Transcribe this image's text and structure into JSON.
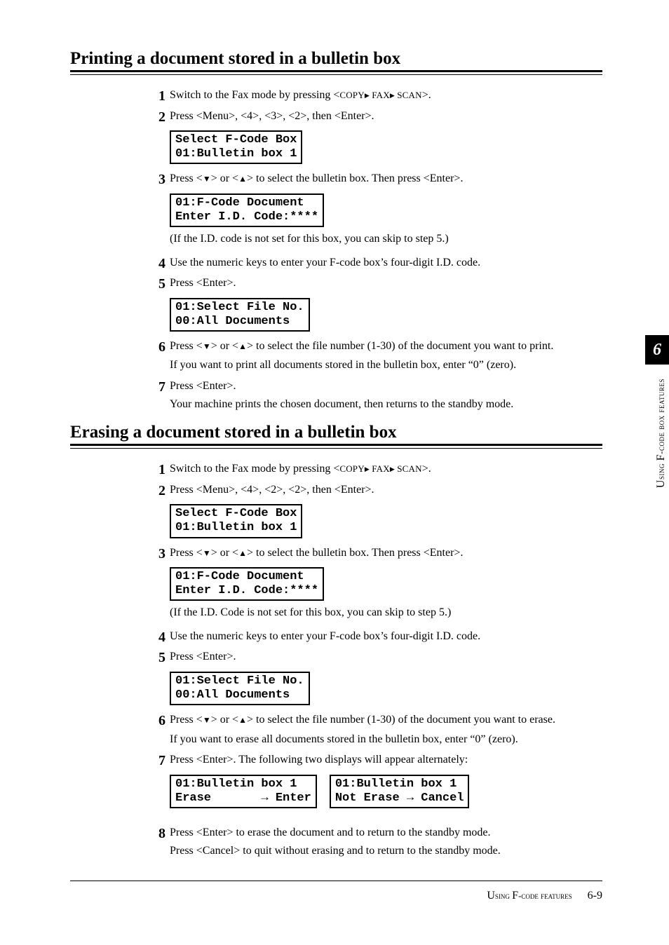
{
  "section1": {
    "title": "Printing a document stored in a bulletin box",
    "steps": [
      {
        "n": "1",
        "body": [
          {
            "t": "line",
            "parts": [
              "Switch to the Fax mode by pressing <",
              "SC:COPY",
              "TRI",
              "SC: FAX",
              "TRI",
              "SC: SCAN",
              ">."
            ]
          }
        ]
      },
      {
        "n": "2",
        "body": [
          {
            "t": "line",
            "text": "Press <Menu>, <4>, <3>, <2>, then <Enter>."
          }
        ],
        "lcd": [
          "Select F-Code Box",
          "01:Bulletin box 1"
        ]
      },
      {
        "n": "3",
        "body": [
          {
            "t": "line",
            "parts": [
              "Press <",
              "DOWN",
              "> or <",
              "UP",
              "> to select the bulletin box.  Then press <Enter>."
            ]
          }
        ],
        "lcd": [
          "01:F-Code Document",
          "Enter I.D. Code:****"
        ],
        "trail": "(If the I.D. code is not set for this box, you can skip to step 5.)"
      },
      {
        "n": "4",
        "body": [
          {
            "t": "line",
            "text": "Use the numeric keys to enter your F-code box’s four-digit I.D. code."
          }
        ]
      },
      {
        "n": "5",
        "body": [
          {
            "t": "line",
            "text": "Press <Enter>."
          }
        ],
        "lcd": [
          "01:Select File No.",
          "00:All Documents"
        ]
      },
      {
        "n": "6",
        "body": [
          {
            "t": "line",
            "parts": [
              "Press <",
              "DOWN",
              "> or <",
              "UP",
              "> to select the file number (1-30) of the document you want to print."
            ]
          },
          {
            "t": "line",
            "text": "If you want to print all documents stored in the bulletin box, enter “0” (zero)."
          }
        ]
      },
      {
        "n": "7",
        "body": [
          {
            "t": "line",
            "text": "Press <Enter>."
          },
          {
            "t": "line",
            "text": "Your machine prints the chosen document, then returns to the standby mode."
          }
        ]
      }
    ]
  },
  "section2": {
    "title": "Erasing a document stored in a bulletin box",
    "steps": [
      {
        "n": "1",
        "body": [
          {
            "t": "line",
            "parts": [
              "Switch to the Fax mode by pressing <",
              "SC:COPY",
              "TRI",
              "SC: FAX",
              "TRI",
              "SC: SCAN",
              ">."
            ]
          }
        ]
      },
      {
        "n": "2",
        "body": [
          {
            "t": "line",
            "text": "Press <Menu>, <4>, <2>, <2>, then <Enter>."
          }
        ],
        "lcd": [
          "Select F-Code Box",
          "01:Bulletin box 1"
        ]
      },
      {
        "n": "3",
        "body": [
          {
            "t": "line",
            "parts": [
              "Press <",
              "DOWN",
              "> or <",
              "UP",
              "> to select the bulletin box.  Then press <Enter>."
            ]
          }
        ],
        "lcd": [
          "01:F-Code Document",
          "Enter I.D. Code:****"
        ],
        "trail": "(If the I.D. Code is not set for this box, you can skip to step 5.)"
      },
      {
        "n": "4",
        "body": [
          {
            "t": "line",
            "text": "Use the numeric keys to enter your F-code box’s four-digit I.D. code."
          }
        ]
      },
      {
        "n": "5",
        "body": [
          {
            "t": "line",
            "text": "Press <Enter>."
          }
        ],
        "lcd": [
          "01:Select File No.",
          "00:All Documents"
        ]
      },
      {
        "n": "6",
        "body": [
          {
            "t": "line",
            "parts": [
              "Press <",
              "DOWN",
              "> or <",
              "UP",
              "> to select the file number (1-30) of the document you want to erase."
            ]
          },
          {
            "t": "line",
            "text": "If you want to erase all documents stored in the bulletin box, enter “0” (zero)."
          }
        ]
      },
      {
        "n": "7",
        "body": [
          {
            "t": "line",
            "text": "Press <Enter>.  The following two displays will appear alternately:"
          }
        ],
        "lcdpair": [
          [
            "01:Bulletin box 1",
            "Erase       → Enter"
          ],
          [
            "01:Bulletin box 1",
            "Not Erase → Cancel"
          ]
        ]
      },
      {
        "n": "8",
        "body": [
          {
            "t": "line",
            "text": "Press <Enter> to erase the document and to return to the standby mode."
          },
          {
            "t": "line",
            "text": "Press <Cancel> to quit without erasing and to return to the standby mode."
          }
        ]
      }
    ]
  },
  "side": {
    "tab": "6",
    "label_sc1": "U",
    "label_rest1": "sing ",
    "label_big": "F",
    "label_sc2": "-code box features"
  },
  "footer": {
    "sc1": "U",
    "rest1": "sing ",
    "big": "F",
    "sc2": "-code features",
    "page": "6-9"
  }
}
